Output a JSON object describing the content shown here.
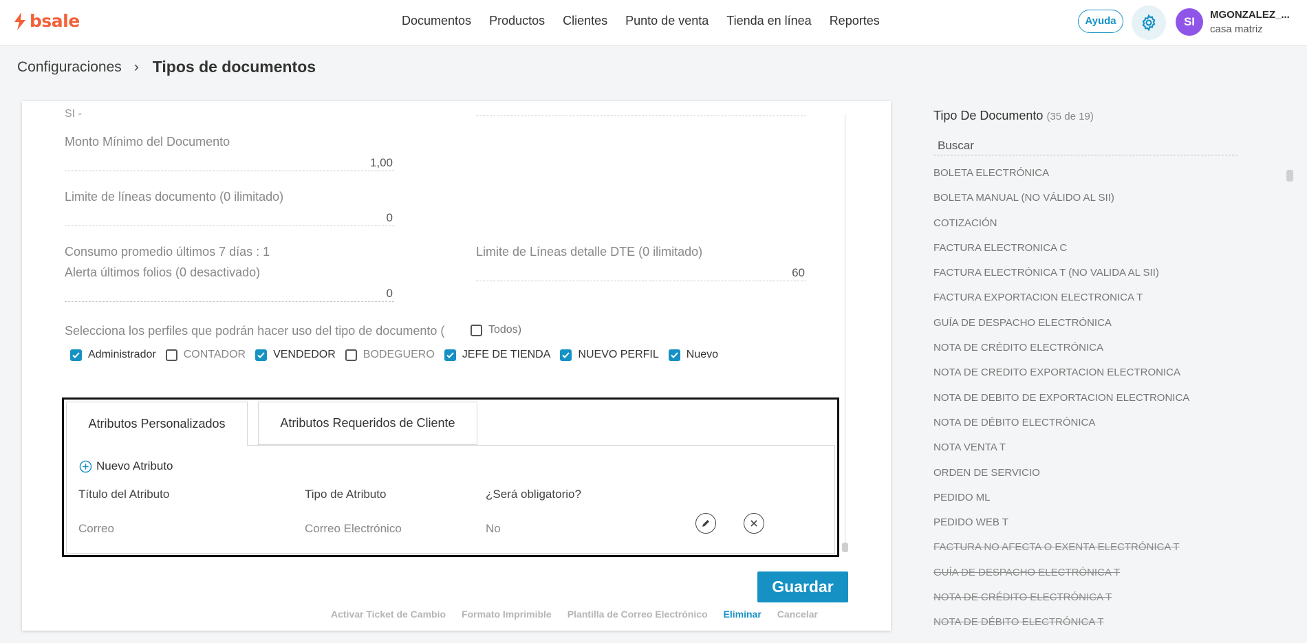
{
  "brand": {
    "name": "bsale",
    "color": "#f2603a"
  },
  "nav": {
    "items": [
      "Documentos",
      "Productos",
      "Clientes",
      "Punto de venta",
      "Tienda en línea",
      "Reportes"
    ]
  },
  "header": {
    "help_label": "Ayuda",
    "user_initials": "SI",
    "user_name": "MGONZALEZ_...",
    "user_branch": "casa matriz"
  },
  "breadcrumb": {
    "parent": "Configuraciones",
    "separator": "›",
    "current": "Tipos de documentos"
  },
  "form": {
    "top_cut_text": "SI -",
    "min_amount_label": "Monto Mínimo del Documento",
    "min_amount_value": "1,00",
    "line_limit_label": "Limite de líneas documento (0 ilimitado)",
    "line_limit_value": "0",
    "avg_consumption_label": "Consumo promedio últimos 7 días : 1",
    "folio_alert_label": "Alerta últimos folios (0 desactivado)",
    "folio_alert_value": "0",
    "dte_limit_label": "Limite de Líneas detalle DTE (0 ilimitado)",
    "dte_limit_value": "60",
    "profiles_label": "Selecciona los perfiles que podrán hacer uso del tipo de documento (",
    "all_label": "Todos",
    "all_close": ")",
    "all_checked": false,
    "profiles": [
      {
        "label": "Administrador",
        "checked": true
      },
      {
        "label": "CONTADOR",
        "checked": false
      },
      {
        "label": "VENDEDOR",
        "checked": true
      },
      {
        "label": "BODEGUERO",
        "checked": false
      },
      {
        "label": "JEFE DE TIENDA",
        "checked": true
      },
      {
        "label": "NUEVO PERFIL",
        "checked": true
      },
      {
        "label": "Nuevo",
        "checked": true
      }
    ]
  },
  "attributes": {
    "tabs": [
      "Atributos Personalizados",
      "Atributos Requeridos de Cliente"
    ],
    "new_label": "Nuevo Atributo",
    "columns": [
      "Título del Atributo",
      "Tipo de Atributo",
      "¿Será obligatorio?"
    ],
    "rows": [
      {
        "title": "Correo",
        "type": "Correo Electrónico",
        "required": "No"
      }
    ]
  },
  "actions": {
    "save_label": "Guardar",
    "links": [
      "Activar Ticket de Cambio",
      "Formato Imprimible",
      "Plantilla de Correo Electrónico",
      "Eliminar",
      "Cancelar"
    ]
  },
  "sidebar": {
    "title": "Tipo De Documento",
    "count": "(35 de 19)",
    "search_placeholder": "Buscar",
    "items": [
      {
        "label": "BOLETA ELECTRÓNICA",
        "inactive": false
      },
      {
        "label": "BOLETA MANUAL (NO VÁLIDO AL SII)",
        "inactive": false
      },
      {
        "label": "COTIZACIÓN",
        "inactive": false
      },
      {
        "label": "FACTURA ELECTRONICA C",
        "inactive": false
      },
      {
        "label": "FACTURA ELECTRÓNICA T (NO VALIDA AL SII)",
        "inactive": false
      },
      {
        "label": "FACTURA EXPORTACION ELECTRONICA T",
        "inactive": false
      },
      {
        "label": "GUÍA DE DESPACHO ELECTRÓNICA",
        "inactive": false
      },
      {
        "label": "NOTA DE CRÉDITO ELECTRÓNICA",
        "inactive": false
      },
      {
        "label": "NOTA DE CREDITO EXPORTACION ELECTRONICA",
        "inactive": false
      },
      {
        "label": "NOTA DE DEBITO DE EXPORTACION ELECTRONICA",
        "inactive": false
      },
      {
        "label": "NOTA DE DÉBITO ELECTRÓNICA",
        "inactive": false
      },
      {
        "label": "NOTA VENTA T",
        "inactive": false
      },
      {
        "label": "ORDEN DE SERVICIO",
        "inactive": false
      },
      {
        "label": "PEDIDO ML",
        "inactive": false
      },
      {
        "label": "PEDIDO WEB T",
        "inactive": false
      },
      {
        "label": "FACTURA NO AFECTA O EXENTA ELECTRÓNICA T",
        "inactive": true
      },
      {
        "label": "GUÍA DE DESPACHO ELECTRÓNICA T",
        "inactive": true
      },
      {
        "label": "NOTA DE CRÉDITO ELECTRÓNICA T",
        "inactive": true
      },
      {
        "label": "NOTA DE DÉBITO ELECTRÓNICA T",
        "inactive": true
      }
    ]
  },
  "colors": {
    "accent": "#1591c4",
    "avatar": "#8f55e8"
  }
}
